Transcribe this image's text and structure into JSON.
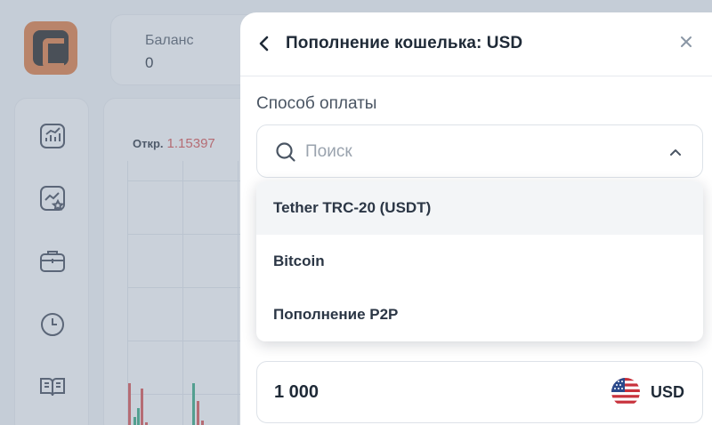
{
  "balance": {
    "label": "Баланс",
    "value": "0"
  },
  "chart": {
    "open_label": "Откр.",
    "open_value": "1.15397"
  },
  "nav": {
    "icons": [
      "chart-trend-icon",
      "star-chart-icon",
      "briefcase-icon",
      "clock-icon",
      "book-icon"
    ]
  },
  "modal": {
    "title": "Пополнение кошелька: USD",
    "payment_method_label": "Способ оплаты",
    "search_placeholder": "Поиск",
    "options": [
      {
        "label": "Tether TRC-20 (USDT)",
        "highlighted": true
      },
      {
        "label": "Bitcoin",
        "highlighted": false
      },
      {
        "label": "Пополнение P2P",
        "highlighted": false
      }
    ],
    "amount": "1 000",
    "currency": "USD"
  },
  "colors": {
    "brand": "#d9743a",
    "price_down": "#d24b4b",
    "candle_up": "#2aa37a"
  }
}
